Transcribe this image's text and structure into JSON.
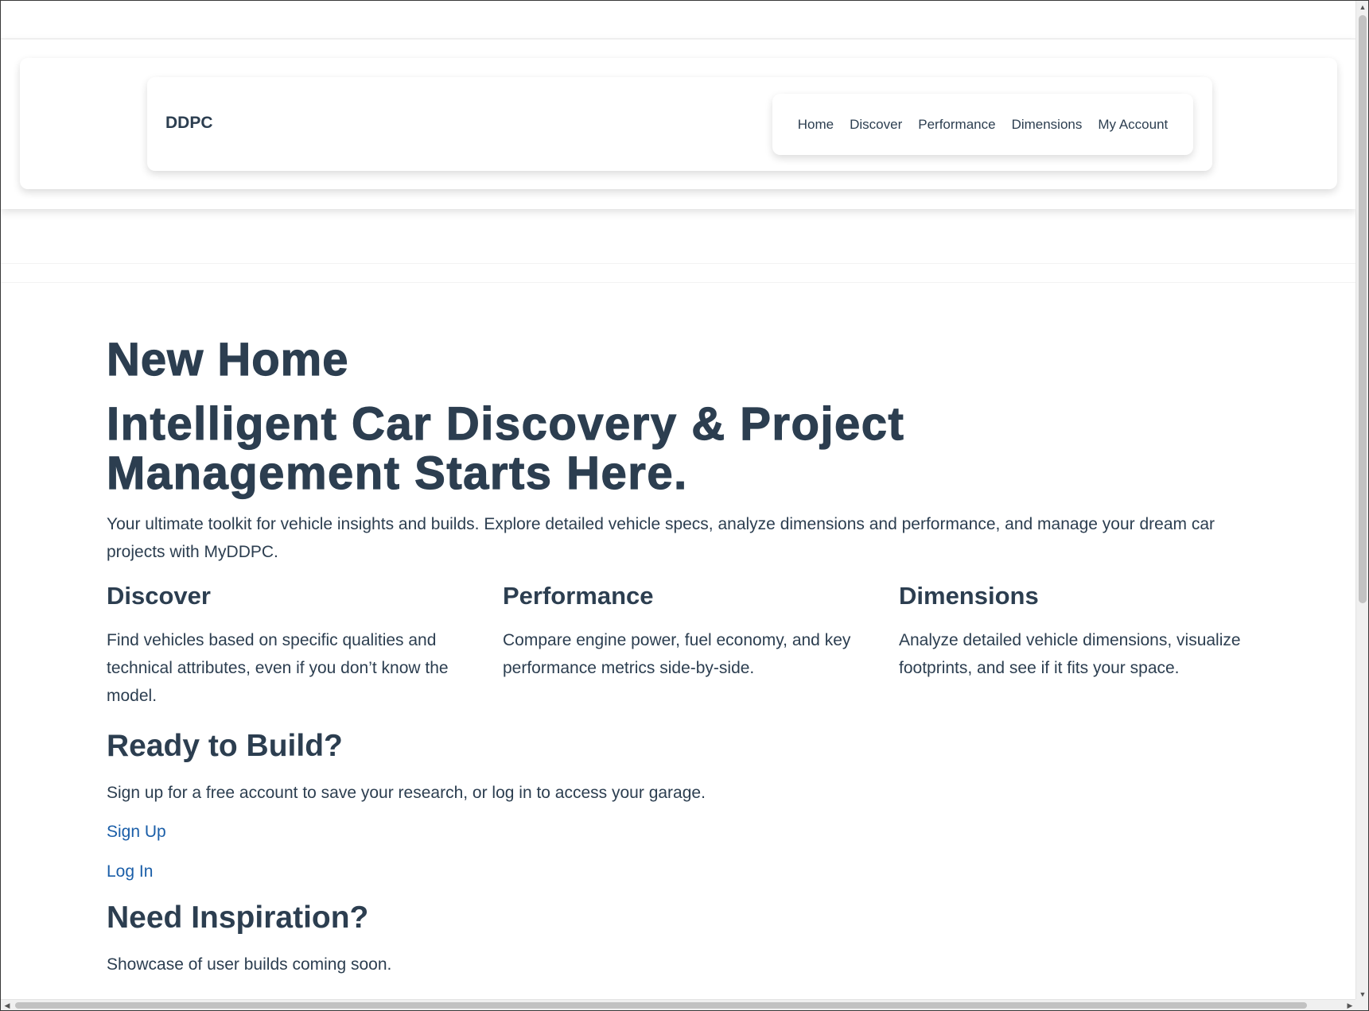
{
  "header": {
    "brand": "DDPC",
    "nav": [
      {
        "label": "Home"
      },
      {
        "label": "Discover"
      },
      {
        "label": "Performance"
      },
      {
        "label": "Dimensions"
      },
      {
        "label": "My Account"
      }
    ]
  },
  "main": {
    "page_heading": "New Home",
    "hero_heading": "Intelligent Car Discovery & Project Management Starts Here.",
    "lead": "Your ultimate toolkit for vehicle insights and builds. Explore detailed vehicle specs, analyze dimensions and performance, and manage your dream car projects with MyDDPC.",
    "features": [
      {
        "title": "Discover",
        "text": "Find vehicles based on specific qualities and technical attributes, even if you don’t know the model."
      },
      {
        "title": "Performance",
        "text": "Compare engine power, fuel economy, and key performance metrics side-by-side."
      },
      {
        "title": "Dimensions",
        "text": "Analyze detailed vehicle dimensions, visualize footprints, and see if it fits your space."
      }
    ],
    "build": {
      "heading": "Ready to Build?",
      "text": "Sign up for a free account to save your research, or log in to access your garage.",
      "signup_label": "Sign Up",
      "login_label": "Log In"
    },
    "inspiration": {
      "heading": "Need Inspiration?",
      "text": "Showcase of user builds coming soon."
    }
  },
  "colors": {
    "text": "#2c3e50",
    "link": "#1a5ea8",
    "background": "#ffffff"
  }
}
